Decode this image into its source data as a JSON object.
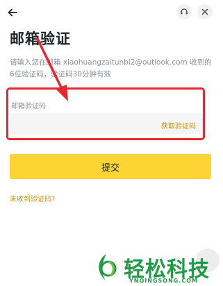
{
  "header": {
    "back_icon": "arrow-left-icon",
    "support_icon": "headset-icon",
    "close_icon": "close-icon"
  },
  "page": {
    "title": "邮箱验证",
    "description": "请输入您在邮箱 xiaohuangzaitunbi2@outlook.com 收到的6位验证码，验证码30分钟有效"
  },
  "form": {
    "code_label": "邮箱验证码",
    "code_value": "",
    "get_code_label": "获取验证码",
    "submit_label": "提交",
    "no_code_label": "未收到验证码?"
  },
  "colors": {
    "accent": "#fcd535",
    "link": "#c99400",
    "annotation": "#e8262f",
    "watermark": "#1f9a45"
  },
  "watermark": {
    "text": "轻松科技",
    "url": "YNQINGSONG.COM"
  }
}
